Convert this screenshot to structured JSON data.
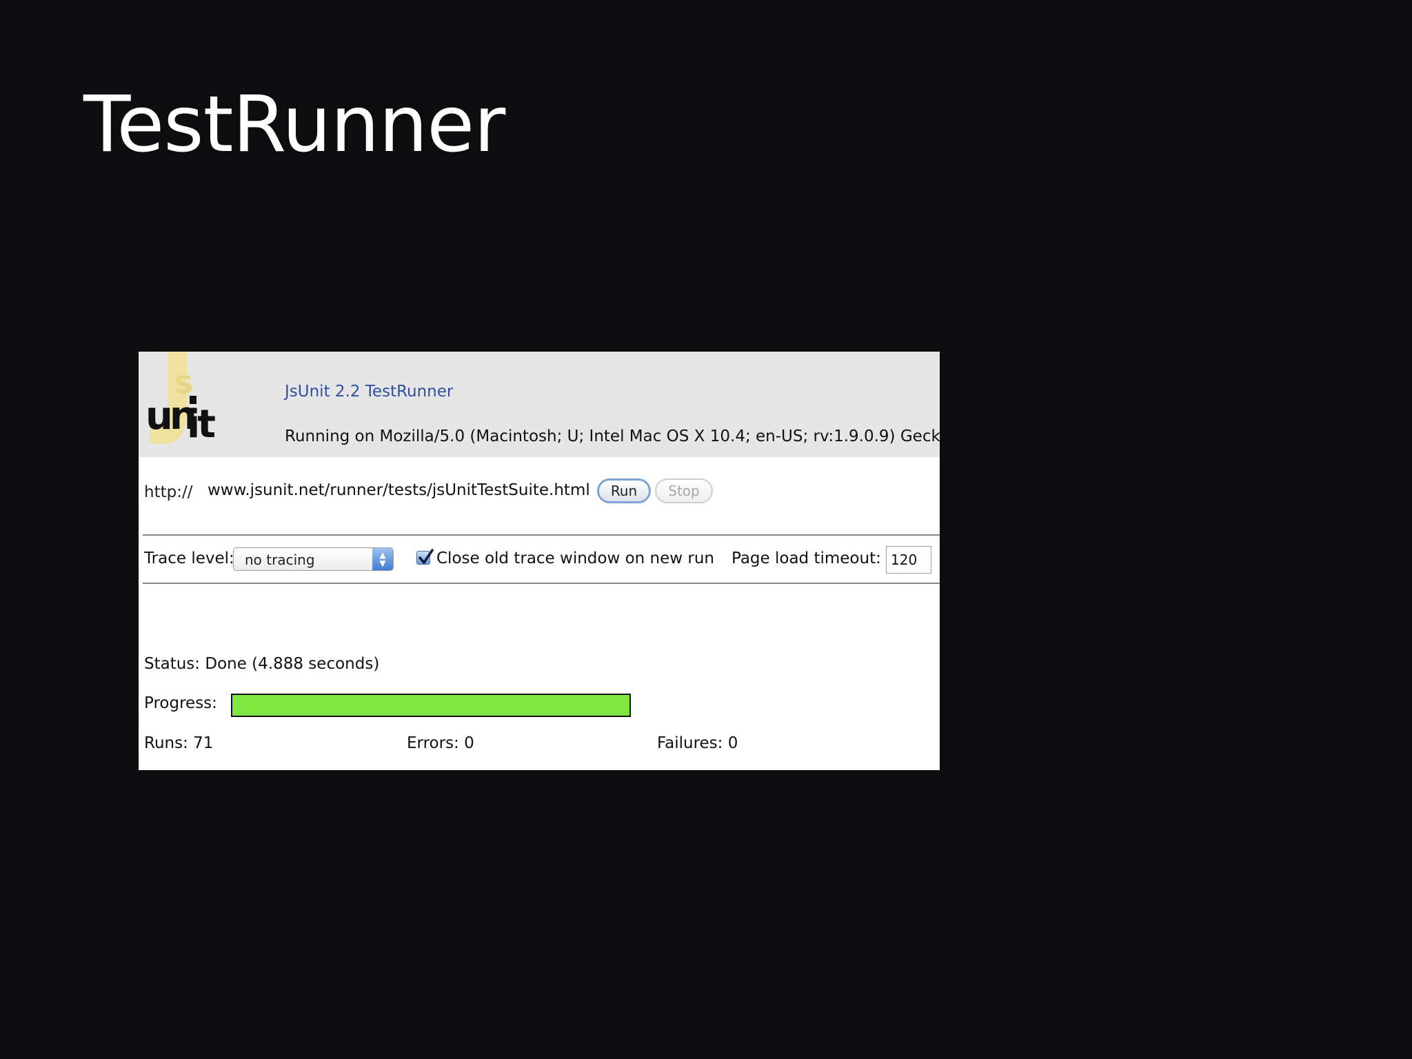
{
  "slide": {
    "title": "TestRunner"
  },
  "runner": {
    "logo_text": "Jsunit",
    "app_name": "JsUnit 2.2 TestRunner",
    "running_on": "Running on Mozilla/5.0 (Macintosh; U; Intel Mac OS X 10.4; en-US; rv:1.9.0.9) Geck",
    "url_prefix": "http://",
    "url_value": "www.jsunit.net/runner/tests/jsUnitTestSuite.html",
    "run_label": "Run",
    "stop_label": "Stop",
    "trace_label": "Trace level:",
    "trace_value": "no tracing",
    "close_window_label": "Close old trace window on new run",
    "close_window_checked": true,
    "timeout_label": "Page load timeout:",
    "timeout_value": "120",
    "status_label": "Status:",
    "status_value": "Done (4.888 seconds)",
    "progress_label": "Progress:",
    "progress_fraction": 1.0,
    "progress_color": "#7fe642",
    "runs_label": "Runs:",
    "runs_value": "71",
    "errors_label": "Errors:",
    "errors_value": "0",
    "failures_label": "Failures:",
    "failures_value": "0"
  }
}
